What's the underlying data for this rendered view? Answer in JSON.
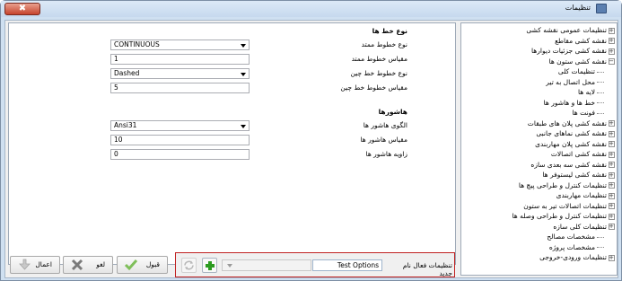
{
  "window": {
    "title": "تنظیمات",
    "close_glyph": "✖"
  },
  "tree": {
    "items": [
      {
        "label": "تنظیمات عمومی نقشه کشی",
        "type": "expander"
      },
      {
        "label": "نقشه کشی مقاطع",
        "type": "expander"
      },
      {
        "label": "نقشه کشی جزئیات دیوارها",
        "type": "expander"
      },
      {
        "label": "نقشه کشی ستون ها",
        "type": "collapse"
      },
      {
        "label": "تنظیمات کلی",
        "type": "leaf"
      },
      {
        "label": "محل اتصال به تیر",
        "type": "leaf"
      },
      {
        "label": "لایه ها",
        "type": "leaf"
      },
      {
        "label": "خط ها و هاشور ها",
        "type": "leaf"
      },
      {
        "label": "فونت ها",
        "type": "leaf"
      },
      {
        "label": "نقشه کشی پلان های طبقات",
        "type": "expander"
      },
      {
        "label": "نقشه کشی نماهای جانبی",
        "type": "expander"
      },
      {
        "label": "نقشه کشی پلان مهاربندی",
        "type": "expander"
      },
      {
        "label": "نقشه کشی اتصالات",
        "type": "expander"
      },
      {
        "label": "نقشه کشی سه بعدی سازه",
        "type": "expander"
      },
      {
        "label": "نقشه کشی لیستوفر ها",
        "type": "expander"
      },
      {
        "label": "تنظیمات کنترل و طراحی پیچ ها",
        "type": "expander"
      },
      {
        "label": "تنظیمات مهاربندی",
        "type": "expander"
      },
      {
        "label": "تنظیمات اتصالات تیر به ستون",
        "type": "expander"
      },
      {
        "label": "تنظیمات کنترل و طراحی وصله ها",
        "type": "expander"
      },
      {
        "label": "تنظیمات کلی سازه",
        "type": "expander"
      },
      {
        "label": "مشخصات مصالح",
        "type": "leaf"
      },
      {
        "label": "مشخصات پروژه",
        "type": "leaf"
      },
      {
        "label": "تنظیمات ورودی-خروجی",
        "type": "expander"
      }
    ]
  },
  "linetypes": {
    "heading": "نوع خط ها",
    "fields": [
      {
        "label": "نوع خطوط ممتد",
        "value": "CONTINUOUS",
        "kind": "combo"
      },
      {
        "label": "مقیاس خطوط ممتد",
        "value": "1",
        "kind": "text"
      },
      {
        "label": "نوع خطوط خط چین",
        "value": "Dashed",
        "kind": "combo"
      },
      {
        "label": "مقیاس خطوط خط چین",
        "value": "5",
        "kind": "text"
      }
    ]
  },
  "hatches": {
    "heading": "هاشورها",
    "fields": [
      {
        "label": "الگوی هاشور ها",
        "value": "Ansi31",
        "kind": "combo"
      },
      {
        "label": "مقیاس هاشور ها",
        "value": "10",
        "kind": "text"
      },
      {
        "label": "زاویه هاشور ها",
        "value": "0",
        "kind": "text"
      }
    ]
  },
  "preset": {
    "label": "تنظیمات فعال نام جدید",
    "input_value": "Test Options",
    "combo_value": ""
  },
  "buttons": {
    "ok": "قبول",
    "cancel": "لغو",
    "apply": "اعمال"
  },
  "colors": {
    "accent_red": "#c02020",
    "add_green": "#2b9b20",
    "ok_check": "#7fbf5a",
    "cancel_x": "#7a7a7a"
  }
}
